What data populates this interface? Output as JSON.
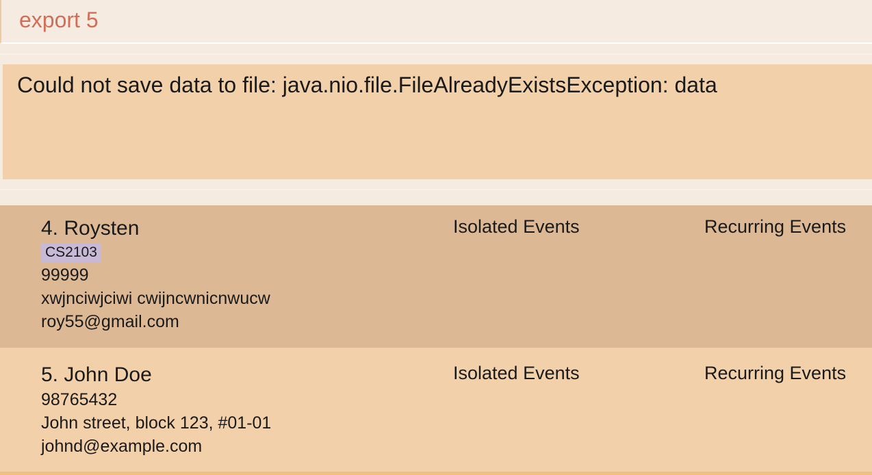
{
  "command": {
    "value": "export 5"
  },
  "result": {
    "message": "Could not save data to file: java.nio.file.FileAlreadyExistsException: data"
  },
  "persons": [
    {
      "name": "4. Roysten",
      "tag": "CS2103",
      "phone": "99999",
      "address": "xwjnciwjciwi cwijncwnicnwucw",
      "email": "roy55@gmail.com",
      "isolated_label": "Isolated Events",
      "recurring_label": "Recurring Events"
    },
    {
      "name": "5. John Doe",
      "phone": "98765432",
      "address": "John street, block 123, #01-01",
      "email": "johnd@example.com",
      "isolated_label": "Isolated Events",
      "recurring_label": "Recurring Events"
    }
  ]
}
